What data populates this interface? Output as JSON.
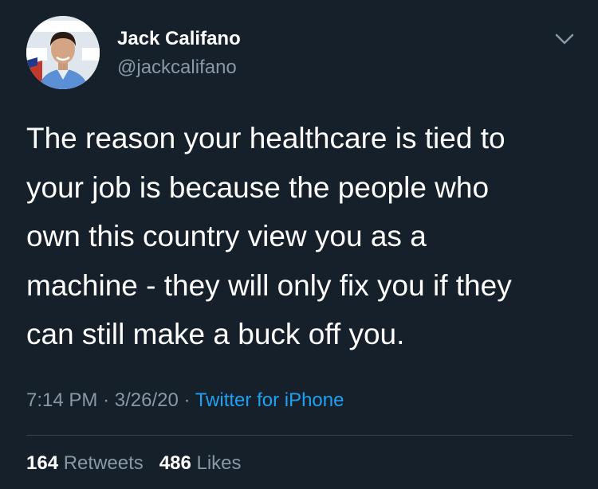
{
  "tweet": {
    "author": {
      "display_name": "Jack Califano",
      "handle": "@jackcalifano"
    },
    "text_lines": [
      "The reason your healthcare is tied to",
      "your job is because the people who",
      "own this country view you as a",
      "machine - they will only fix you if they",
      "can still make a buck off you."
    ],
    "meta": {
      "time": "7:14 PM",
      "separator": "·",
      "date": "3/26/20",
      "source": "Twitter for iPhone"
    },
    "stats": {
      "retweets_count": "164",
      "retweets_label": "Retweets",
      "likes_count": "486",
      "likes_label": "Likes"
    }
  },
  "icons": {
    "menu_caret": "chevron-down-icon"
  },
  "colors": {
    "background": "#15202b",
    "secondary_text": "#8899a6",
    "link": "#1da1f2",
    "divider": "#38444d"
  }
}
